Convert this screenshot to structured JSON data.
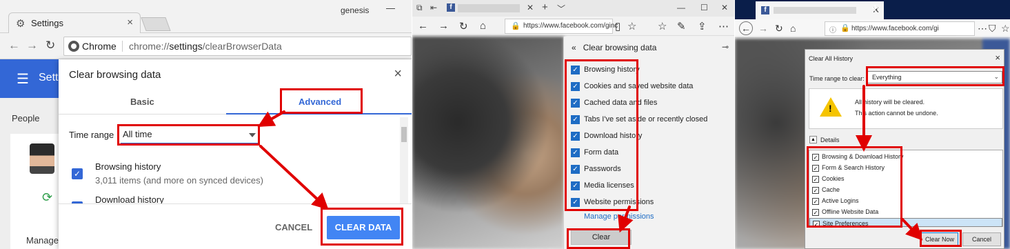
{
  "chrome": {
    "tab_title": "Settings",
    "tab_close": "×",
    "profile_name": "genesis",
    "minimize": "—",
    "omnibox_chip": "Chrome",
    "url_prefix": "chrome://",
    "url_path": "settings",
    "url_suffix": "/clearBrowserData",
    "appbar_title": "Setti",
    "people_heading": "People",
    "manage_label": "Manage",
    "dialog": {
      "title": "Clear browsing data",
      "close": "×",
      "tab_basic": "Basic",
      "tab_advanced": "Advanced",
      "time_range_label": "Time range",
      "time_range_value": "All time",
      "items": [
        {
          "title": "Browsing history",
          "subtitle": "3,011 items (and more on synced devices)"
        },
        {
          "title": "Download history"
        }
      ],
      "cancel_label": "CANCEL",
      "clear_label": "CLEAR DATA"
    }
  },
  "edge": {
    "url": "https://www.facebook.com/ginc",
    "pane": {
      "title": "Clear browsing data",
      "options": [
        "Browsing history",
        "Cookies and saved website data",
        "Cached data and files",
        "Tabs I've set aside or recently closed",
        "Download history",
        "Form data",
        "Passwords",
        "Media licenses",
        "Website permissions"
      ],
      "manage_link": "Manage permissions",
      "clear_label": "Clear"
    }
  },
  "firefox": {
    "url": "https://www.facebook.com/gi",
    "dialog": {
      "title": "Clear All History",
      "close": "×",
      "time_range_label": "Time range to clear:",
      "time_range_value": "Everything",
      "warning_line1": "All history will be cleared.",
      "warning_line2": "This action cannot be undone.",
      "details_label": "Details",
      "items": [
        "Browsing & Download History",
        "Form & Search History",
        "Cookies",
        "Cache",
        "Active Logins",
        "Offline Website Data",
        "Site Preferences"
      ],
      "clear_now_label": "Clear Now",
      "cancel_label": "Cancel"
    }
  },
  "colors": {
    "annotation": "#e00000",
    "chrome_accent": "#3367d6",
    "chrome_button": "#4285f4",
    "edge_checkbox": "#1e6cc4",
    "firefox_tabbar": "#0a1e4a"
  }
}
